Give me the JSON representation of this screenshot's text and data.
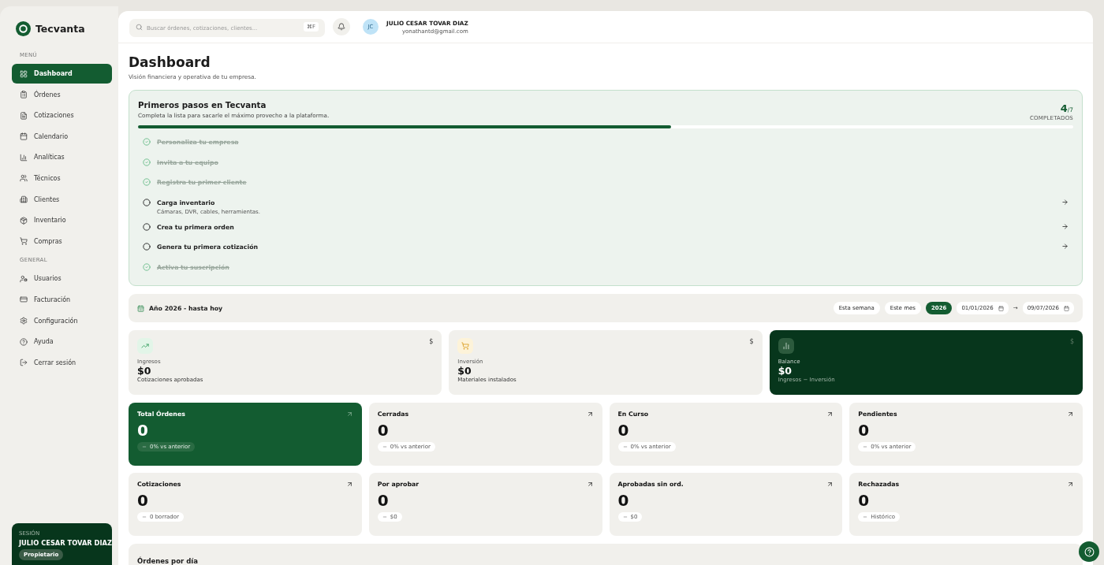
{
  "brand": {
    "name": "Tecvanta"
  },
  "sidebar": {
    "sections": [
      {
        "label": "MENÚ",
        "items": [
          {
            "label": "Dashboard",
            "selected": true
          },
          {
            "label": "Órdenes",
            "selected": false
          },
          {
            "label": "Cotizaciones",
            "selected": false
          },
          {
            "label": "Calendario",
            "selected": false
          },
          {
            "label": "Analíticas",
            "selected": false
          },
          {
            "label": "Técnicos",
            "selected": false
          },
          {
            "label": "Clientes",
            "selected": false
          },
          {
            "label": "Inventario",
            "selected": false
          },
          {
            "label": "Compras",
            "selected": false
          }
        ]
      },
      {
        "label": "GENERAL",
        "items": [
          {
            "label": "Usuarios",
            "selected": false
          },
          {
            "label": "Facturación",
            "selected": false
          },
          {
            "label": "Configuración",
            "selected": false
          },
          {
            "label": "Ayuda",
            "selected": false
          },
          {
            "label": "Cerrar sesión",
            "selected": false
          }
        ]
      }
    ],
    "session": {
      "label": "SESIÓN",
      "name": "JULIO CESAR TOVAR DIAZ",
      "role": "Propietario"
    }
  },
  "topbar": {
    "search": {
      "placeholder": "Buscar órdenes, cotizaciones, clientes...",
      "shortcut": "⌘F"
    },
    "user": {
      "initials": "JC",
      "name": "JULIO CESAR TOVAR DIAZ",
      "email": "yonathantd@gmail.com"
    }
  },
  "page": {
    "title": "Dashboard",
    "subtitle": "Visión financiera y operativa de tu empresa."
  },
  "onboarding": {
    "title": "Primeros pasos en Tecvanta",
    "subtitle": "Completa la lista para sacarle el máximo provecho a la plataforma.",
    "count": "4",
    "total": "/7",
    "count_label": "COMPLETADOS",
    "level": 0.57,
    "steps": [
      {
        "label": "Personaliza tu empresa",
        "done": true
      },
      {
        "label": "Invita a tu equipo",
        "done": true
      },
      {
        "label": "Registra tu primer cliente",
        "done": true
      },
      {
        "label": "Carga inventario",
        "detail": "Cámaras, DVR, cables, herramientas.",
        "done": false
      },
      {
        "label": "Crea tu primera orden",
        "done": false
      },
      {
        "label": "Genera tu primera cotización",
        "done": false
      },
      {
        "label": "Activa tu suscripción",
        "done": true
      }
    ]
  },
  "period": {
    "label": "Año 2026 - hasta hoy",
    "ranges": [
      {
        "label": "Esta semana",
        "selected": false
      },
      {
        "label": "Este mes",
        "selected": false
      },
      {
        "label": "2026",
        "selected": true
      }
    ],
    "from": "01/01/2026",
    "separator": "→",
    "to": "09/07/2026"
  },
  "finance": [
    {
      "kind": "income",
      "label": "Ingresos",
      "value": "$0",
      "note": "Cotizaciones aprobadas",
      "currency": "$"
    },
    {
      "kind": "investment",
      "label": "Inversión",
      "value": "$0",
      "note": "Materiales instalados",
      "currency": "$"
    },
    {
      "kind": "balance",
      "label": "Balance",
      "value": "$0",
      "note": "Ingresos − Inversión",
      "currency": "$"
    }
  ],
  "metrics": [
    {
      "title": "Total Órdenes",
      "value": "0",
      "chip": "0% vs anterior",
      "highlighted": true
    },
    {
      "title": "Cerradas",
      "value": "0",
      "chip": "0% vs anterior",
      "highlighted": false
    },
    {
      "title": "En Curso",
      "value": "0",
      "chip": "0% vs anterior",
      "highlighted": false
    },
    {
      "title": "Pendientes",
      "value": "0",
      "chip": "0% vs anterior",
      "highlighted": false
    },
    {
      "title": "Cotizaciones",
      "value": "0",
      "chip": "0 borrador",
      "highlighted": false
    },
    {
      "title": "Por aprobar",
      "value": "0",
      "chip": "$0",
      "highlighted": false
    },
    {
      "title": "Aprobadas sin ord.",
      "value": "0",
      "chip": "$0",
      "highlighted": false
    },
    {
      "title": "Rechazadas",
      "value": "0",
      "chip": "Histórico",
      "highlighted": false
    }
  ],
  "chart_section": {
    "title": "Órdenes por día"
  }
}
